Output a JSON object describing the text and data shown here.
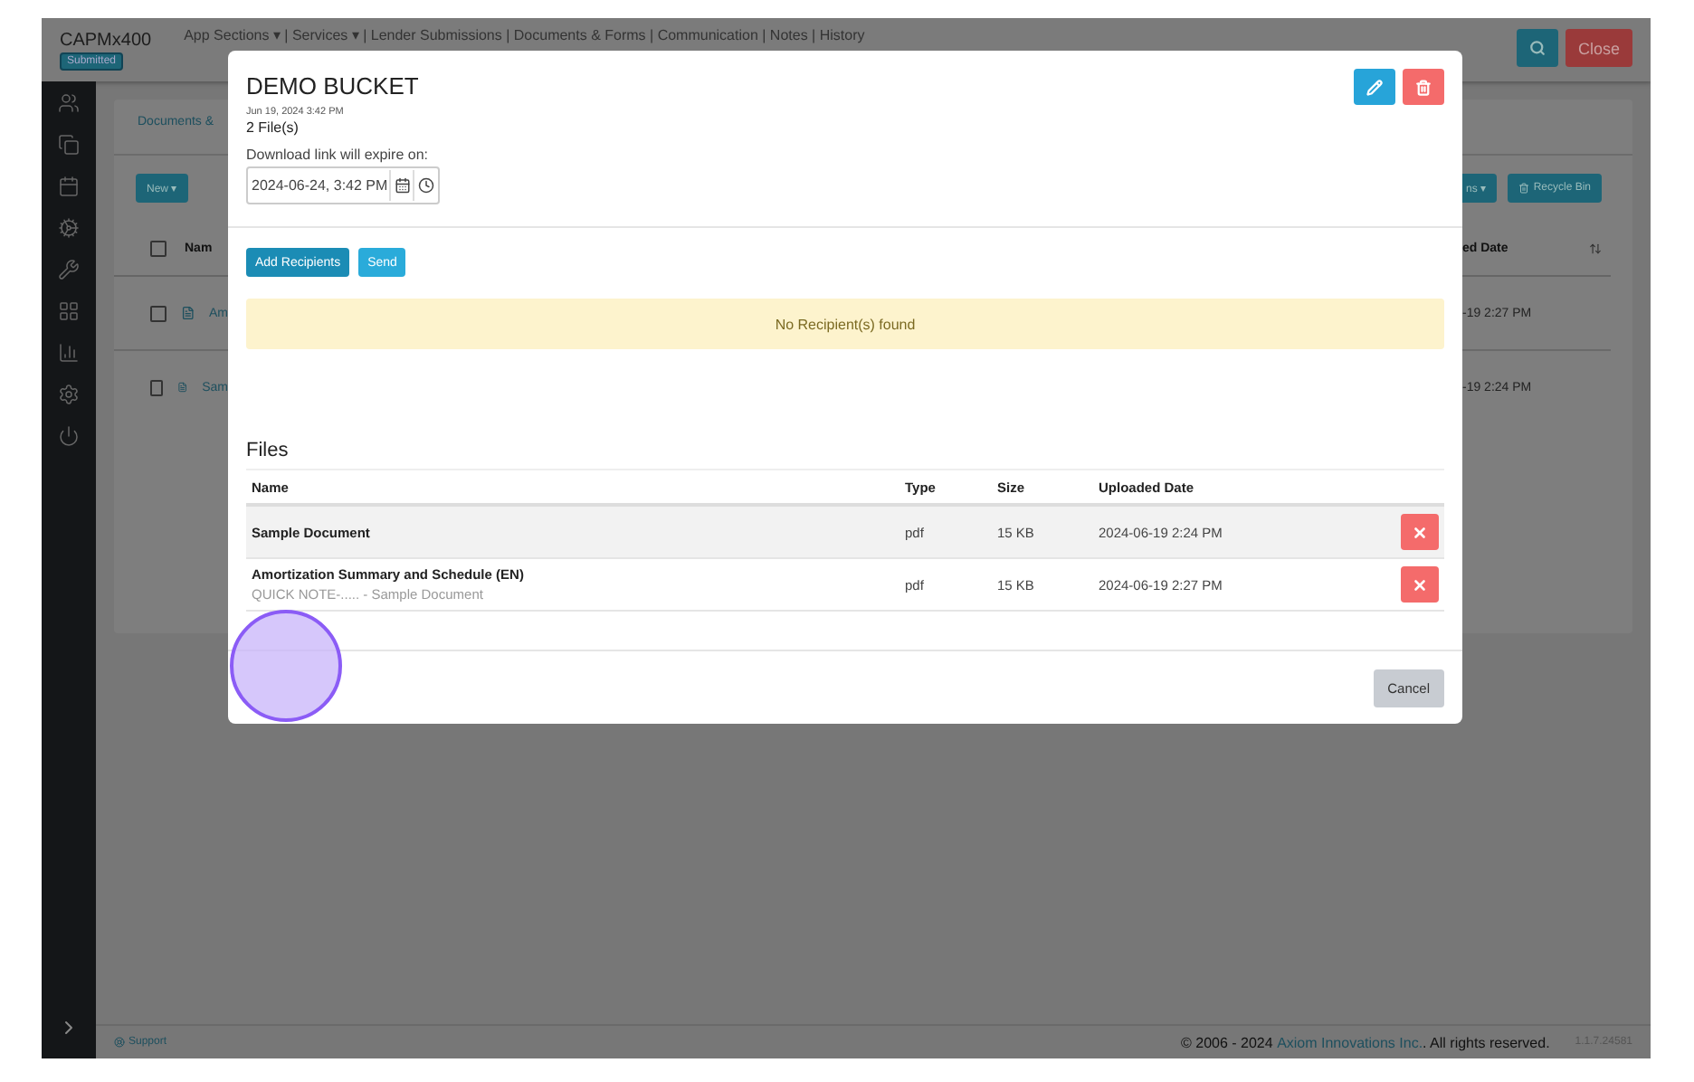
{
  "header": {
    "brand": "CAPMx400",
    "status_badge": "Submitted",
    "nav": "App Sections ▾ | Services ▾ | Lender Submissions | Documents & Forms | Communication | Notes | History",
    "close_button": "Close"
  },
  "background_panel": {
    "tab": "Documents &",
    "new_button": "New ▾",
    "actions_button": "ns ▾",
    "recycle_button": "Recycle Bin",
    "name_header": "Nam",
    "select_all_checked": false,
    "date_header": "ed Date",
    "rows": [
      {
        "name": "Am",
        "date": "-19 2:27 PM",
        "checked": false
      },
      {
        "name": "Sam",
        "date": "-19 2:24 PM",
        "checked": false
      }
    ]
  },
  "modal": {
    "title": "DEMO BUCKET",
    "created": "Jun 19, 2024 3:42 PM",
    "file_count": "2 File(s)",
    "expiry_label": "Download link will expire on:",
    "expiry_value": "2024-06-24, 3:42 PM",
    "buttons": [
      "Add Recipients",
      "Send"
    ],
    "alert": "No Recipient(s) found",
    "files_heading": "Files",
    "columns": [
      "Name",
      "Type",
      "Size",
      "Uploaded Date"
    ],
    "files": [
      {
        "name": "Sample Document",
        "type": "pdf",
        "size": "15 KB",
        "uploaded": "2024-06-19 2:24 PM",
        "highlighted": true
      },
      {
        "name": "Amortization Summary and Schedule (EN)",
        "note": "QUICK NOTE-..... - Sample Document",
        "type": "pdf",
        "size": "15 KB",
        "uploaded": "2024-06-19 2:27 PM",
        "highlighted": false
      }
    ],
    "cancel_button": "Cancel"
  },
  "footer": {
    "support_link": "Support",
    "copyright": "© 2006 - 2024",
    "company_link": "Axiom Innovations Inc.",
    "rights": ". All rights reserved.",
    "version": "1.1.7.24581"
  }
}
